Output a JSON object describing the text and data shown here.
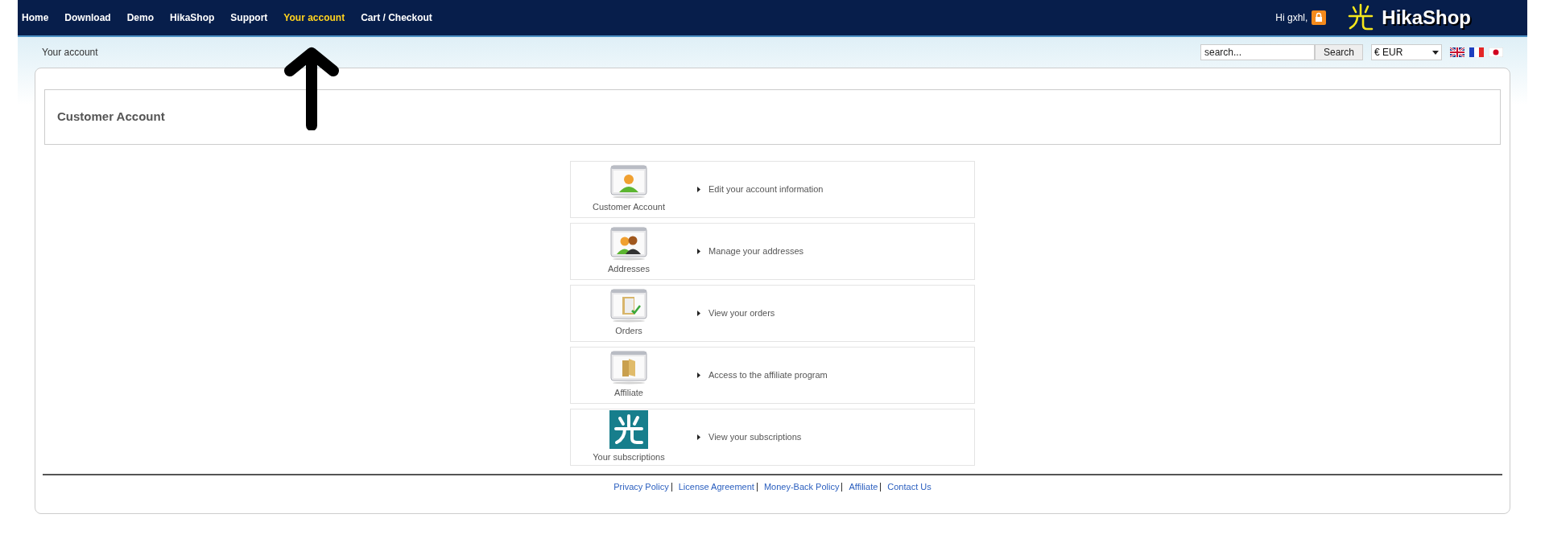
{
  "nav": {
    "items": [
      {
        "label": "Home",
        "selected": false
      },
      {
        "label": "Download",
        "selected": false
      },
      {
        "label": "Demo",
        "selected": false
      },
      {
        "label": "HikaShop",
        "selected": false
      },
      {
        "label": "Support",
        "selected": false
      },
      {
        "label": "Your account",
        "selected": true
      },
      {
        "label": "Cart / Checkout",
        "selected": false
      }
    ],
    "greeting": "Hi gxhl,",
    "logo": "HikaShop"
  },
  "breadcrumb": "Your account",
  "search": {
    "placeholder": "search...",
    "button": "Search"
  },
  "currency": "€ EUR",
  "title": "Customer Account",
  "menu": [
    {
      "kind": "account",
      "label": "Customer Account",
      "description": "Edit your account information"
    },
    {
      "kind": "addresses",
      "label": "Addresses",
      "description": "Manage your addresses"
    },
    {
      "kind": "orders",
      "label": "Orders",
      "description": "View your orders"
    },
    {
      "kind": "affiliate",
      "label": "Affiliate",
      "description": "Access to the affiliate program"
    },
    {
      "kind": "subscriptions",
      "label": "Your subscriptions",
      "description": "View your subscriptions"
    }
  ],
  "footer": [
    "Privacy Policy",
    "License Agreement",
    "Money-Back Policy",
    "Affiliate",
    "Contact Us"
  ]
}
